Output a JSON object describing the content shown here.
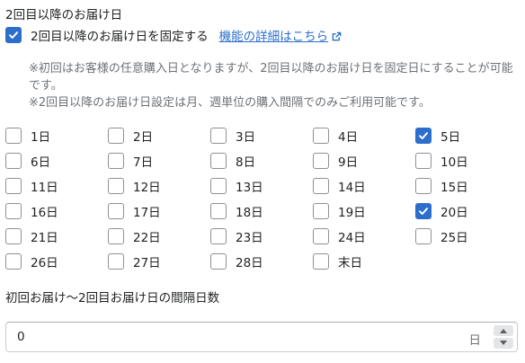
{
  "section_title": "2回目以降のお届け日",
  "fixed_date": {
    "label": "2回目以降のお届け日を固定する",
    "checked": true,
    "details_link": "機能の詳細はこちら"
  },
  "help_text": {
    "line1": "※初回はお客様の任意購入日となりますが、2回目以降のお届け日を固定日にすることが可能です。",
    "line2": "※2回目以降のお届け日設定は月、週単位の購入間隔でのみご利用可能です。"
  },
  "days": [
    {
      "label": "1日",
      "checked": false
    },
    {
      "label": "2日",
      "checked": false
    },
    {
      "label": "3日",
      "checked": false
    },
    {
      "label": "4日",
      "checked": false
    },
    {
      "label": "5日",
      "checked": true
    },
    {
      "label": "6日",
      "checked": false
    },
    {
      "label": "7日",
      "checked": false
    },
    {
      "label": "8日",
      "checked": false
    },
    {
      "label": "9日",
      "checked": false
    },
    {
      "label": "10日",
      "checked": false
    },
    {
      "label": "11日",
      "checked": false
    },
    {
      "label": "12日",
      "checked": false
    },
    {
      "label": "13日",
      "checked": false
    },
    {
      "label": "14日",
      "checked": false
    },
    {
      "label": "15日",
      "checked": false
    },
    {
      "label": "16日",
      "checked": false
    },
    {
      "label": "17日",
      "checked": false
    },
    {
      "label": "18日",
      "checked": false
    },
    {
      "label": "19日",
      "checked": false
    },
    {
      "label": "20日",
      "checked": true
    },
    {
      "label": "21日",
      "checked": false
    },
    {
      "label": "22日",
      "checked": false
    },
    {
      "label": "23日",
      "checked": false
    },
    {
      "label": "24日",
      "checked": false
    },
    {
      "label": "25日",
      "checked": false
    },
    {
      "label": "26日",
      "checked": false
    },
    {
      "label": "27日",
      "checked": false
    },
    {
      "label": "28日",
      "checked": false
    },
    {
      "label": "末日",
      "checked": false
    }
  ],
  "interval": {
    "label": "初回お届け〜2回目お届け日の間隔日数",
    "value": "0",
    "suffix": "日"
  },
  "colors": {
    "accent": "#2c6ecb",
    "text": "#202223",
    "subdued": "#6d7175",
    "border": "#8c9196"
  },
  "icons": {
    "external_link": "external-link-icon",
    "check": "checkmark-icon",
    "step_up": "caret-up-icon",
    "step_down": "caret-down-icon"
  }
}
